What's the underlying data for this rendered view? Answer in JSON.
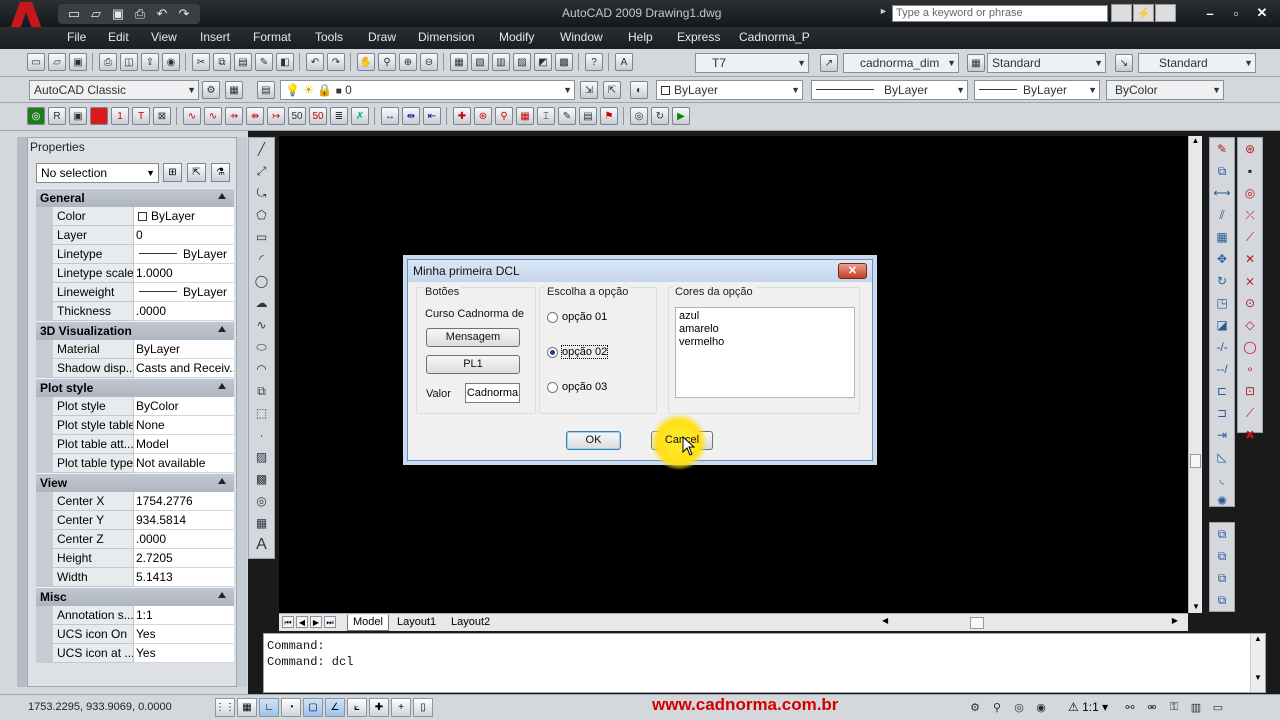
{
  "window": {
    "title": "AutoCAD 2009  Drawing1.dwg",
    "search_placeholder": "Type a keyword or phrase"
  },
  "menu": [
    "File",
    "Edit",
    "View",
    "Insert",
    "Format",
    "Tools",
    "Draw",
    "Dimension",
    "Modify",
    "Window",
    "Help",
    "Express",
    "Cadnorma_P"
  ],
  "toolbar": {
    "text_style": "T7",
    "dim_style": "cadnorma_dim",
    "table_style": "Standard",
    "mleader_style": "Standard",
    "workspace": "AutoCAD Classic",
    "layer": "0",
    "color": "ByLayer",
    "linetype": "ByLayer",
    "lineweight": "ByLayer",
    "plotstyle": "ByColor"
  },
  "properties": {
    "title": "Properties",
    "selection": "No selection",
    "sections": [
      {
        "name": "General",
        "rows": [
          {
            "k": "Color",
            "v": "ByLayer",
            "kind": "swatch"
          },
          {
            "k": "Layer",
            "v": "0"
          },
          {
            "k": "Linetype",
            "v": "ByLayer",
            "kind": "line"
          },
          {
            "k": "Linetype scale",
            "v": "1.0000"
          },
          {
            "k": "Lineweight",
            "v": "ByLayer",
            "kind": "line"
          },
          {
            "k": "Thickness",
            "v": ".0000"
          }
        ]
      },
      {
        "name": "3D Visualization",
        "rows": [
          {
            "k": "Material",
            "v": "ByLayer"
          },
          {
            "k": "Shadow disp...",
            "v": "Casts and Receiv..."
          }
        ]
      },
      {
        "name": "Plot style",
        "rows": [
          {
            "k": "Plot style",
            "v": "ByColor"
          },
          {
            "k": "Plot style table",
            "v": "None"
          },
          {
            "k": "Plot table att...",
            "v": "Model"
          },
          {
            "k": "Plot table type",
            "v": "Not available"
          }
        ]
      },
      {
        "name": "View",
        "rows": [
          {
            "k": "Center X",
            "v": "1754.2776"
          },
          {
            "k": "Center Y",
            "v": "934.5814"
          },
          {
            "k": "Center Z",
            "v": ".0000"
          },
          {
            "k": "Height",
            "v": "2.7205"
          },
          {
            "k": "Width",
            "v": "5.1413"
          }
        ]
      },
      {
        "name": "Misc",
        "rows": [
          {
            "k": "Annotation s...",
            "v": "1:1"
          },
          {
            "k": "UCS icon On",
            "v": "Yes"
          },
          {
            "k": "UCS icon at ...",
            "v": "Yes"
          }
        ]
      }
    ]
  },
  "tabs": {
    "model": "Model",
    "layout1": "Layout1",
    "layout2": "Layout2"
  },
  "dialog": {
    "title": "Minha primeira DCL",
    "group_buttons": "Botões",
    "course_label": "Curso Cadnorma de",
    "btn_mensagem": "Mensagem",
    "btn_pl1": "PL1",
    "valor_label": "Valor",
    "valor_value": "Cadnorma",
    "group_options": "Escolha a opção",
    "options": [
      "opção 01",
      "opção 02",
      "opção 03"
    ],
    "selected_option": 1,
    "group_colors": "Cores da opção",
    "colors": [
      "azul",
      "amarelo",
      "vermelho"
    ],
    "ok": "OK",
    "cancel": "Cancel"
  },
  "command": {
    "line1": "Command:",
    "line2": "Command: dcl"
  },
  "status": {
    "coords": "1753.2295, 933.9069, 0.0000",
    "website": "www.cadnorma.com.br",
    "scale": "1:1"
  }
}
